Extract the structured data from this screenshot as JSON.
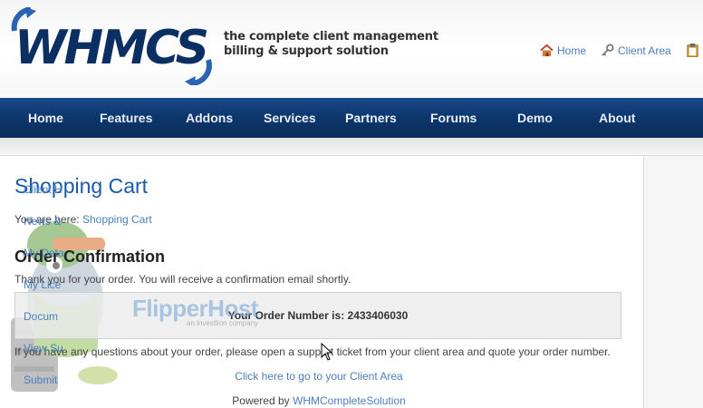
{
  "header": {
    "logo_text": "WHMCS",
    "tagline_line1": "the complete client management",
    "tagline_line2": "billing & support solution",
    "top_links": [
      {
        "label": "Home",
        "icon": "house-icon"
      },
      {
        "label": "Client Area",
        "icon": "key-icon"
      }
    ]
  },
  "nav": {
    "items": [
      "Home",
      "Features",
      "Addons",
      "Services",
      "Partners",
      "Forums",
      "Demo",
      "About"
    ]
  },
  "page": {
    "title": "Shopping Cart",
    "breadcrumb_prefix": "You are here:",
    "breadcrumb_link": "Shopping Cart",
    "section_title": "Order Confirmation",
    "thanks_text": "Thank you for your order. You will receive a confirmation email shortly.",
    "order_number_text": "Your Order Number is: 2433406030",
    "questions_text": "If you have any questions about your order, please open a support ticket from your client area and quote your order number.",
    "client_area_link": "Click here to go to your Client Area",
    "powered_prefix": "Powered by",
    "powered_link": "WHMCompleteSolution"
  },
  "watermark": {
    "brand": "FlipperHost",
    "sub": "an investlion company"
  },
  "sidebar": {
    "links": [
      "Client H",
      "News &",
      "My Deta",
      "My Lice",
      "Docum",
      "View Su",
      "Submit"
    ]
  },
  "colors": {
    "nav_bg": "#0d366b",
    "link": "#4a7fbf",
    "title": "#1a5aa8"
  }
}
